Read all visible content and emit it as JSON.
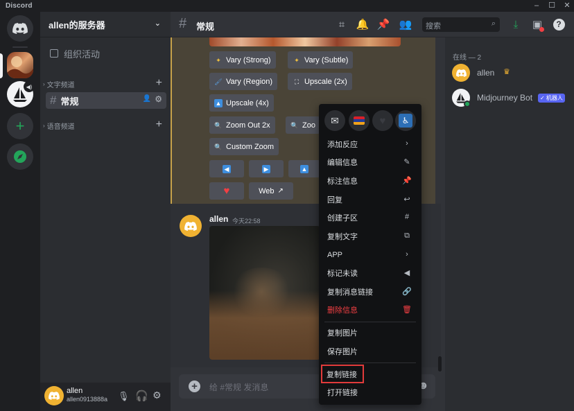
{
  "app": {
    "title": "Discord"
  },
  "titlebar": {
    "min": "–",
    "max": "☐",
    "close": "✕"
  },
  "server": {
    "name": "allen的服务器"
  },
  "sidebar": {
    "events_label": "组织活动",
    "text_category": "文字频道",
    "voice_category": "语音频道",
    "channel_name": "常规"
  },
  "user": {
    "name": "allen",
    "tag": "allen0913888a"
  },
  "header": {
    "channel": "常规",
    "search_placeholder": "搜索"
  },
  "members": {
    "online_label": "在线 — 2",
    "list": [
      {
        "name": "allen",
        "crown": "♛"
      },
      {
        "name": "Midjourney Bot",
        "badge": "✓ 机器人"
      }
    ]
  },
  "mj_buttons": {
    "vary_strong": "Vary (Strong)",
    "vary_subtle": "Vary (Subtle)",
    "vary_region": "Vary (Region)",
    "upscale_2x": "Upscale (2x)",
    "upscale_4x": "Upscale (4x)",
    "zoom_out_2x": "Zoom Out 2x",
    "zoom_partial": "Zoo",
    "custom_zoom": "Custom Zoom",
    "web": "Web"
  },
  "message": {
    "author": "allen",
    "timestamp": "今天22:58"
  },
  "composer": {
    "placeholder": "给 #常规 发消息"
  },
  "context_menu": {
    "items": [
      {
        "label": "添加反应",
        "icon": "›"
      },
      {
        "label": "编辑信息",
        "icon": "✎"
      },
      {
        "label": "标注信息",
        "icon": "📌"
      },
      {
        "label": "回复",
        "icon": "↩"
      },
      {
        "label": "创建子区",
        "icon": "#"
      },
      {
        "label": "复制文字",
        "icon": "⧉"
      },
      {
        "label": "APP",
        "icon": "›"
      },
      {
        "label": "标记未读",
        "icon": "◀"
      },
      {
        "label": "复制消息链接",
        "icon": "🔗"
      },
      {
        "label": "删除信息",
        "icon": "🗑"
      }
    ],
    "image_items": [
      {
        "label": "复制图片"
      },
      {
        "label": "保存图片"
      }
    ],
    "link_items": [
      {
        "label": "复制链接"
      },
      {
        "label": "打开链接"
      }
    ]
  },
  "colors": {
    "accent": "#5865f2",
    "danger": "#f23f43",
    "highlight": "#e23b3b",
    "online": "#23a55a",
    "mj_accent": "#c7a24a"
  }
}
